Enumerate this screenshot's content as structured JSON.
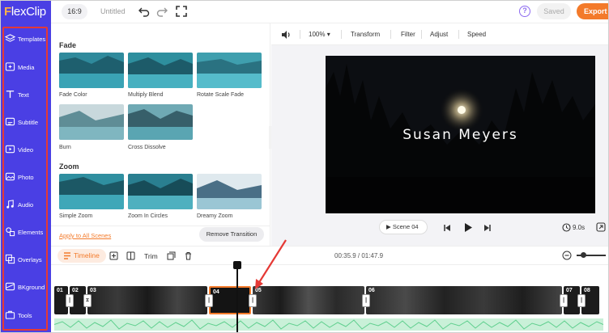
{
  "app": {
    "logo_prefix": "F",
    "logo_text": "lexClip",
    "aspect_ratio": "16:9",
    "project_title": "Untitled",
    "saved_label": "Saved",
    "export_label": "Export",
    "help_label": "?"
  },
  "sidebar": {
    "items": [
      {
        "label": "Templates",
        "icon": "layers-icon"
      },
      {
        "label": "Media",
        "icon": "media-icon"
      },
      {
        "label": "Text",
        "icon": "text-icon"
      },
      {
        "label": "Subtitle",
        "icon": "subtitle-icon"
      },
      {
        "label": "Video",
        "icon": "video-icon"
      },
      {
        "label": "Photo",
        "icon": "photo-icon"
      },
      {
        "label": "Audio",
        "icon": "audio-icon"
      },
      {
        "label": "Elements",
        "icon": "elements-icon"
      },
      {
        "label": "Overlays",
        "icon": "overlays-icon"
      },
      {
        "label": "BKground",
        "icon": "background-icon"
      },
      {
        "label": "Tools",
        "icon": "tools-icon"
      }
    ]
  },
  "transitions": {
    "fade_title": "Fade",
    "fade_items": [
      "Fade Color",
      "Multiply Blend",
      "Rotate Scale Fade",
      "Burn",
      "Cross Dissolve"
    ],
    "zoom_title": "Zoom",
    "zoom_items": [
      "Simple Zoom",
      "Zoom In Circles",
      "Dreamy Zoom"
    ],
    "apply_all": "Apply to All Scenes",
    "remove": "Remove Transition"
  },
  "preview": {
    "zoom": "100%",
    "tools": [
      "Transform",
      "Filter",
      "Adjust",
      "Speed"
    ],
    "video_title": "Susan Meyers",
    "scene_label": "Scene 04",
    "duration": "9.0s"
  },
  "timeline": {
    "tab_label": "Timeline",
    "trim_label": "Trim",
    "time": "00:35.9 / 01:47.9",
    "clips": [
      "01",
      "02",
      "03",
      "04",
      "05",
      "06",
      "07",
      "08"
    ]
  },
  "colors": {
    "brand": "#4a3fe4",
    "accent": "#f37a2a",
    "highlight": "#e53935"
  }
}
